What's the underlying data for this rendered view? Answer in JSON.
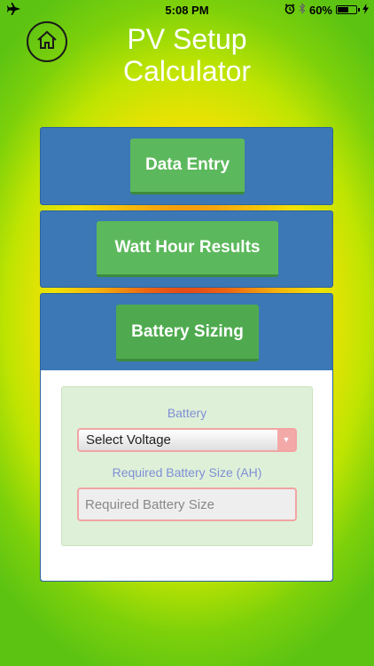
{
  "status_bar": {
    "time": "5:08 PM",
    "battery_percent": "60%",
    "battery_level": 0.6,
    "left_icon": "airplane-icon",
    "right_icons": [
      "alarm-icon",
      "bluetooth-icon",
      "battery-icon",
      "charging-bolt-icon"
    ]
  },
  "header": {
    "home_icon": "home-icon",
    "title_line1": "PV Setup",
    "title_line2": "Calculator"
  },
  "sections": {
    "data_entry_label": "Data Entry",
    "watt_hour_label": "Watt Hour Results",
    "battery_sizing_label": "Battery Sizing"
  },
  "battery_form": {
    "battery_label": "Battery",
    "voltage_select_value": "Select Voltage",
    "required_size_label": "Required Battery Size (AH)",
    "required_size_placeholder": "Required Battery Size"
  },
  "colors": {
    "panel_blue": "#3b78b5",
    "button_green": "#5cb85c",
    "form_green": "#dff0d8",
    "label_blue": "#7f8fd6",
    "field_border": "#f2a4a4"
  }
}
